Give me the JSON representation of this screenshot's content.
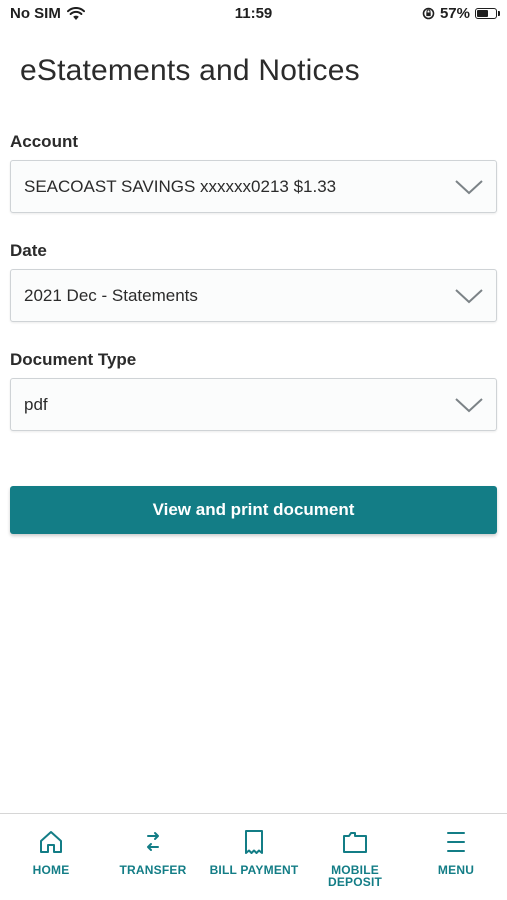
{
  "status_bar": {
    "carrier": "No SIM",
    "time": "11:59",
    "battery_percent": "57%",
    "battery_level": 0.57
  },
  "page": {
    "title": "eStatements and Notices"
  },
  "form": {
    "account": {
      "label": "Account",
      "value": "SEACOAST SAVINGS xxxxxx0213 $1.33"
    },
    "date": {
      "label": "Date",
      "value": "2021 Dec - Statements"
    },
    "document_type": {
      "label": "Document Type",
      "value": "pdf"
    },
    "submit_label": "View and print document"
  },
  "bottom_nav": {
    "items": [
      {
        "label": "HOME",
        "icon": "home-icon"
      },
      {
        "label": "TRANSFER",
        "icon": "transfer-icon"
      },
      {
        "label": "BILL PAYMENT",
        "icon": "receipt-icon"
      },
      {
        "label": "MOBILE DEPOSIT",
        "icon": "deposit-icon"
      },
      {
        "label": "MENU",
        "icon": "menu-icon"
      }
    ]
  },
  "colors": {
    "accent": "#137d86",
    "border": "#cfd3d6",
    "text": "#2b2b2b"
  }
}
